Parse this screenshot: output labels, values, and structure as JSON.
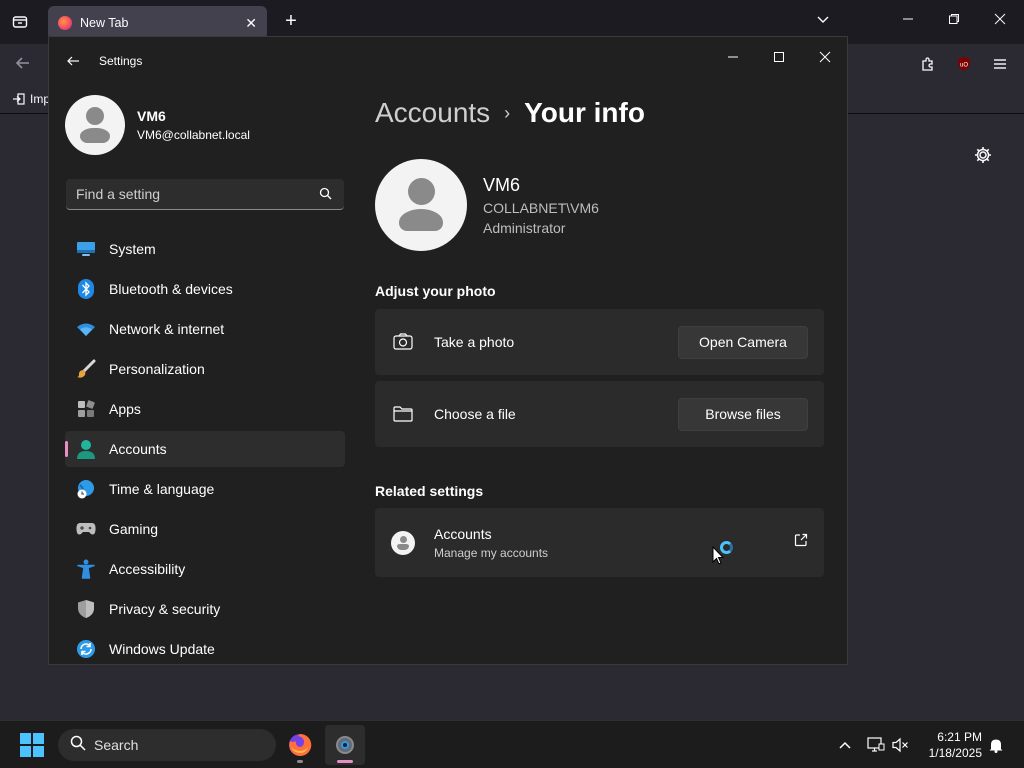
{
  "firefox": {
    "tab_title": "New Tab",
    "bookmark_label": "Imp"
  },
  "settings": {
    "window_title": "Settings",
    "profile": {
      "name": "VM6",
      "email": "VM6@collabnet.local"
    },
    "search_placeholder": "Find a setting",
    "nav_items": [
      {
        "label": "System",
        "icon": "monitor-icon"
      },
      {
        "label": "Bluetooth & devices",
        "icon": "bluetooth-icon"
      },
      {
        "label": "Network & internet",
        "icon": "wifi-icon"
      },
      {
        "label": "Personalization",
        "icon": "brush-icon"
      },
      {
        "label": "Apps",
        "icon": "apps-icon"
      },
      {
        "label": "Accounts",
        "icon": "person-icon",
        "active": true
      },
      {
        "label": "Time & language",
        "icon": "globe-clock-icon"
      },
      {
        "label": "Gaming",
        "icon": "gamepad-icon"
      },
      {
        "label": "Accessibility",
        "icon": "accessibility-icon"
      },
      {
        "label": "Privacy & security",
        "icon": "shield-icon"
      },
      {
        "label": "Windows Update",
        "icon": "update-icon"
      }
    ],
    "breadcrumb": {
      "parent": "Accounts",
      "separator": "›",
      "current": "Your info"
    },
    "user": {
      "name": "VM6",
      "domain": "COLLABNET\\VM6",
      "role": "Administrator"
    },
    "adjust_photo": {
      "title": "Adjust your photo",
      "take_photo_label": "Take a photo",
      "open_camera_button": "Open Camera",
      "choose_file_label": "Choose a file",
      "browse_files_button": "Browse files"
    },
    "related": {
      "title": "Related settings",
      "accounts_title": "Accounts",
      "accounts_subtitle": "Manage my accounts"
    }
  },
  "taskbar": {
    "search_placeholder": "Search",
    "time": "6:21 PM",
    "date": "1/18/2025"
  },
  "colors": {
    "accent": "#4cc2ff",
    "active_indicator": "#e78fc3"
  }
}
